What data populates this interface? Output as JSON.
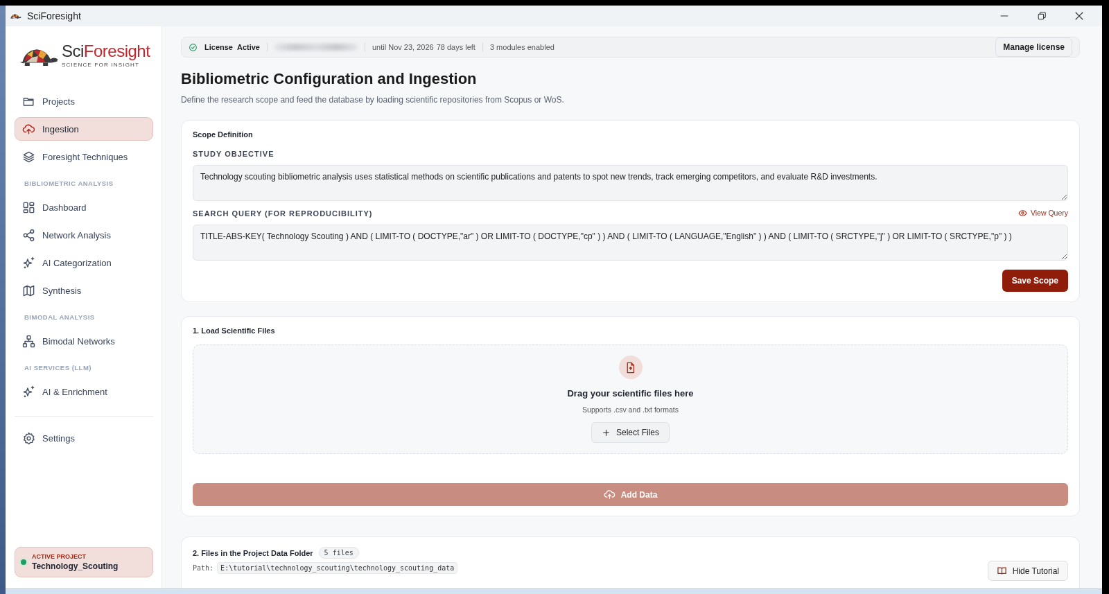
{
  "window": {
    "title": "SciForesight"
  },
  "logo": {
    "name_start": "Sci",
    "name_end": "Foresight",
    "tagline": "SCIENCE FOR INSIGHT"
  },
  "sidebar": {
    "items": [
      {
        "kind": "item",
        "label": "Projects",
        "selected": false
      },
      {
        "kind": "item",
        "label": "Ingestion",
        "selected": true
      },
      {
        "kind": "item",
        "label": "Foresight Techniques",
        "selected": false
      },
      {
        "kind": "section",
        "label": "BIBLIOMETRIC ANALYSIS"
      },
      {
        "kind": "item",
        "label": "Dashboard",
        "selected": false
      },
      {
        "kind": "item",
        "label": "Network Analysis",
        "selected": false
      },
      {
        "kind": "item",
        "label": "AI Categorization",
        "selected": false
      },
      {
        "kind": "item",
        "label": "Synthesis",
        "selected": false
      },
      {
        "kind": "section",
        "label": "BIMODAL ANALYSIS"
      },
      {
        "kind": "item",
        "label": "Bimodal Networks",
        "selected": false
      },
      {
        "kind": "section",
        "label": "AI SERVICES (LLM)"
      },
      {
        "kind": "item",
        "label": "AI & Enrichment",
        "selected": false
      },
      {
        "kind": "divider"
      },
      {
        "kind": "item",
        "label": "Settings",
        "selected": false
      }
    ],
    "active_project": {
      "label": "ACTIVE PROJECT",
      "name": "Technology_Scouting"
    }
  },
  "license": {
    "label": "License",
    "status": "Active",
    "expiry": "until Nov 23, 2026",
    "remaining": "78 days left",
    "modules": "3 modules enabled",
    "button": "Manage license"
  },
  "page": {
    "title": "Bibliometric Configuration and Ingestion",
    "subtitle": "Define the research scope and feed the database by loading scientific repositories from Scopus or WoS."
  },
  "scope": {
    "title": "Scope Definition",
    "objective_label": "STUDY OBJECTIVE",
    "objective_value": "Technology scouting bibliometric analysis uses statistical methods on scientific publications and patents to spot new trends, track emerging competitors, and evaluate R&D investments.",
    "query_label": "SEARCH QUERY (FOR REPRODUCIBILITY)",
    "view_query": "View Query",
    "query_value": "TITLE-ABS-KEY( Technology Scouting ) AND ( LIMIT-TO ( DOCTYPE,\"ar\" ) OR LIMIT-TO ( DOCTYPE,\"cp\" ) ) AND ( LIMIT-TO ( LANGUAGE,\"English\" ) ) AND ( LIMIT-TO ( SRCTYPE,\"j\" ) OR LIMIT-TO ( SRCTYPE,\"p\" ) )",
    "save_button": "Save Scope"
  },
  "load": {
    "title": "1. Load Scientific Files",
    "drop_title": "Drag your scientific files here",
    "drop_hint": "Supports .csv and .txt formats",
    "select_button": "Select Files",
    "add_button": "Add Data",
    "add_disabled": true
  },
  "files": {
    "title": "2. Files in the Project Data Folder",
    "count": "5 files",
    "path_label": "Path:",
    "path": "E:\\tutorial\\technology_scouting\\technology_scouting_data",
    "tutorial_button": "Hide Tutorial"
  }
}
